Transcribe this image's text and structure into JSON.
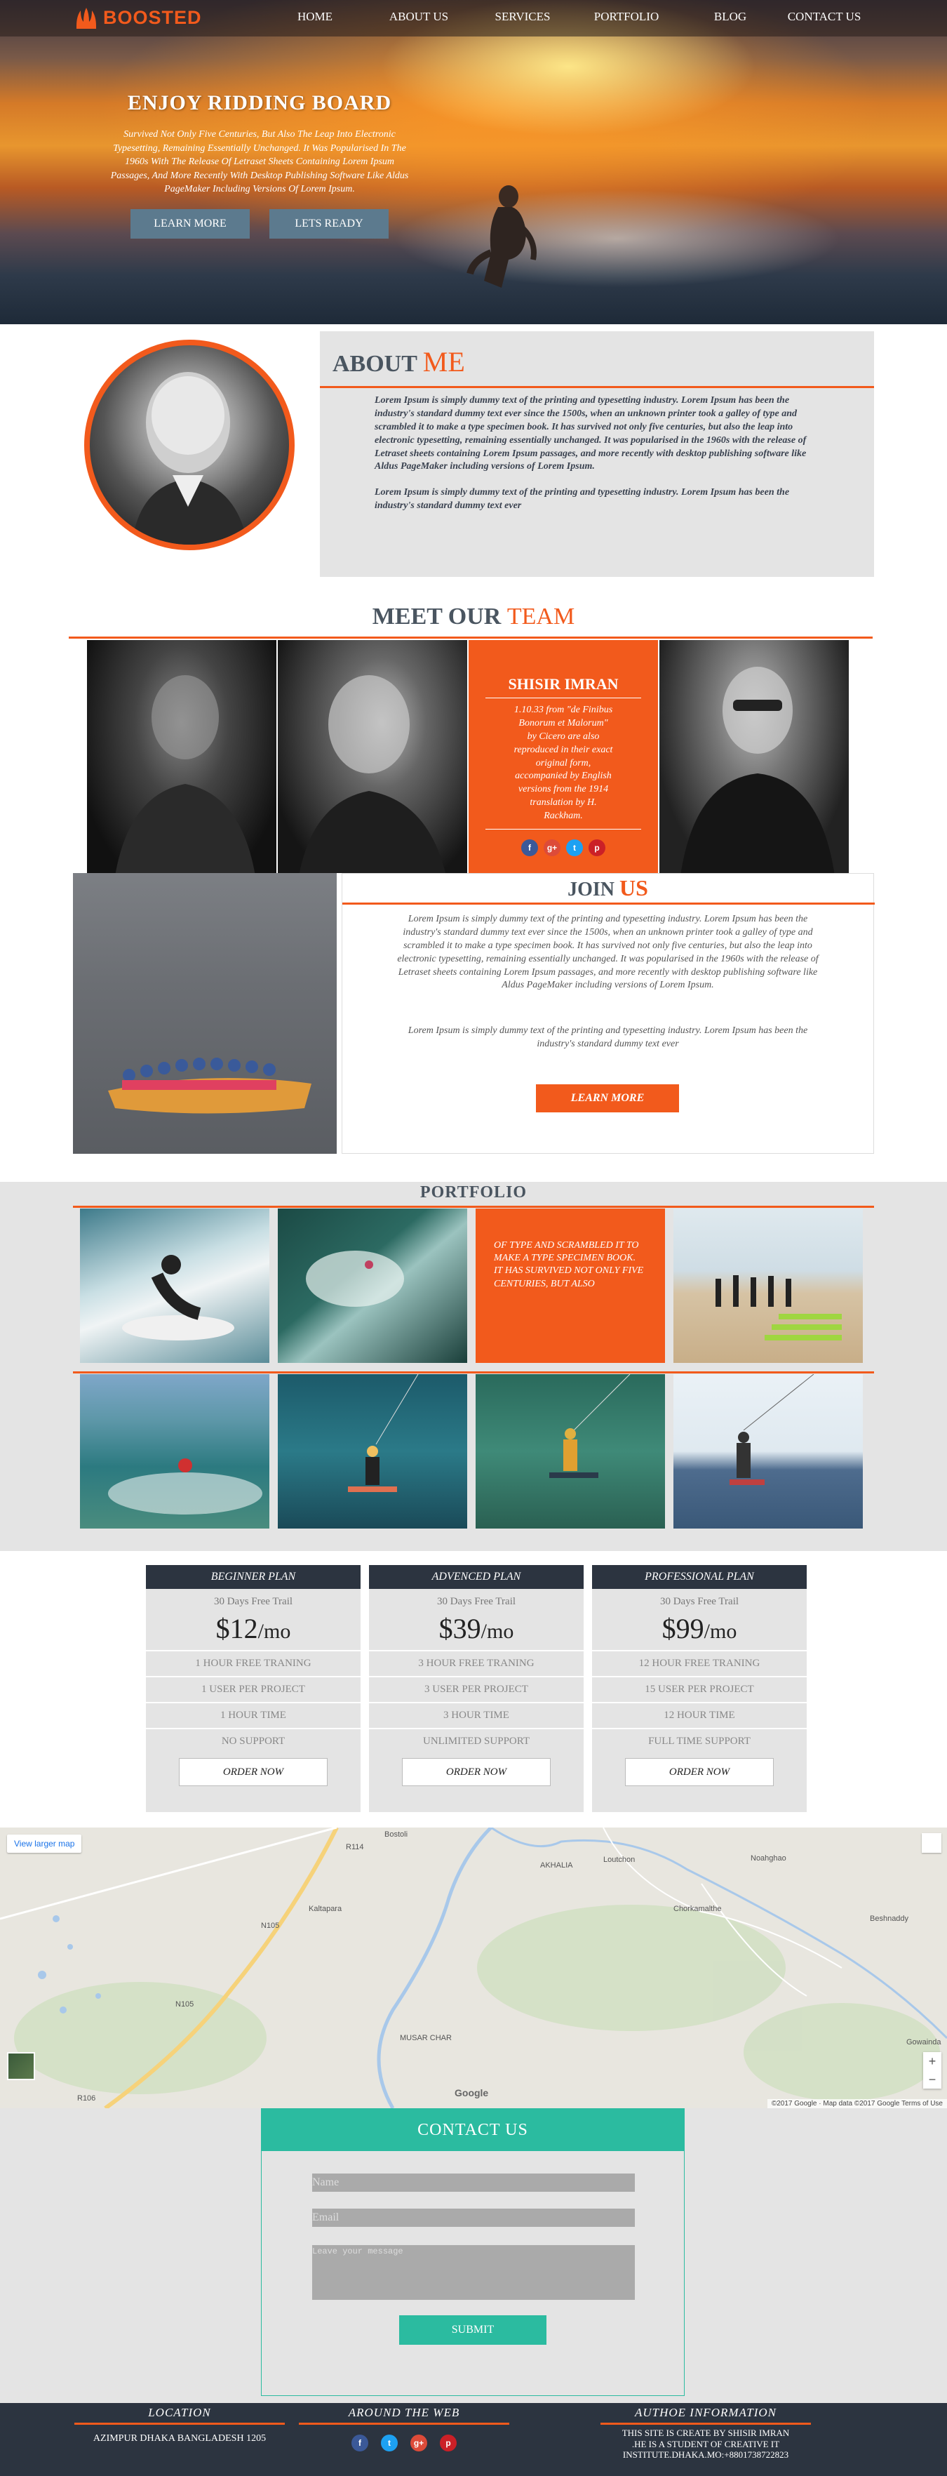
{
  "nav": {
    "logo": "BOOSTED",
    "items": [
      "HOME",
      "ABOUT US",
      "SERVICES",
      "PORTFOLIO",
      "BLOG",
      "CONTACT US"
    ]
  },
  "hero": {
    "title": "ENJOY RIDDING BOARD",
    "text": "Survived Not Only Five Centuries, But Also The Leap Into Electronic Typesetting, Remaining Essentially Unchanged. It Was Popularised In The 1960s With The Release Of Letraset Sheets Containing Lorem Ipsum Passages, And More Recently With Desktop Publishing Software Like Aldus PageMaker Including Versions Of Lorem Ipsum.",
    "btn_learn": "LEARN MORE",
    "btn_ready": "LETS READY"
  },
  "about": {
    "title": "ABOUT",
    "title_accent": "ME",
    "p1": "Lorem Ipsum is simply dummy text of the printing and typesetting industry. Lorem Ipsum has been the industry's standard dummy text ever since the 1500s, when an unknown printer took a galley of type and scrambled it to make a type specimen book. It has survived not only five centuries, but also the leap into electronic typesetting, remaining essentially unchanged. It was popularised in the 1960s with the release of Letraset sheets containing Lorem Ipsum passages, and more recently with desktop publishing software like Aldus PageMaker including versions of Lorem Ipsum.",
    "p2": "Lorem Ipsum is simply dummy text of the printing and typesetting industry. Lorem Ipsum has been the industry's standard dummy text ever"
  },
  "team": {
    "title": "MEET OUR",
    "title_accent": "TEAM",
    "featured_name": "SHISIR IMRAN",
    "featured_desc": "1.10.33 from \"de Finibus Bonorum et Malorum\" by Cicero are also reproduced in their exact original form, accompanied by English versions from the 1914 translation by H. Rackham.",
    "socials": [
      "f",
      "g+",
      "t",
      "p"
    ]
  },
  "join": {
    "title": "JOIN",
    "title_accent": "US",
    "p1": "Lorem Ipsum is simply dummy text of the printing and typesetting industry. Lorem Ipsum has been the industry's standard dummy text ever since the 1500s, when an unknown printer took a galley of type and scrambled it to make a type specimen book. It has survived not only five centuries, but also the leap into electronic typesetting, remaining essentially unchanged. It was popularised in the 1960s with the release of Letraset sheets containing Lorem Ipsum passages, and more recently with desktop publishing software like Aldus PageMaker including versions of Lorem Ipsum.",
    "p2": "Lorem Ipsum is simply dummy text of the printing and typesetting industry. Lorem Ipsum has been the industry's standard dummy text ever",
    "button": "LEARN MORE"
  },
  "portfolio": {
    "title": "PORTFOLIO",
    "caption": "OF TYPE AND SCRAMBLED IT TO MAKE A TYPE SPECIMEN BOOK. IT HAS SURVIVED NOT ONLY FIVE CENTURIES, BUT ALSO"
  },
  "pricing": {
    "plans": [
      {
        "name": "BEGINNER PLAN",
        "trail": "30 Days Free Trail",
        "price": "$12",
        "per": "/mo",
        "features": [
          "1 HOUR FREE TRANING",
          "1 USER PER PROJECT",
          "1 HOUR TIME",
          "NO SUPPORT"
        ],
        "order": "ORDER NOW"
      },
      {
        "name": "ADVENCED PLAN",
        "trail": "30 Days Free Trail",
        "price": "$39",
        "per": "/mo",
        "features": [
          "3 HOUR FREE TRANING",
          "3 USER PER PROJECT",
          "3 HOUR TIME",
          "UNLIMITED SUPPORT"
        ],
        "order": "ORDER NOW"
      },
      {
        "name": "PROFESSIONAL PLAN",
        "trail": "30 Days Free Trail",
        "price": "$99",
        "per": "/mo",
        "features": [
          "12 HOUR FREE TRANING",
          "15 USER PER PROJECT",
          "12 HOUR TIME",
          "FULL TIME SUPPORT"
        ],
        "order": "ORDER NOW"
      }
    ]
  },
  "map": {
    "view_larger": "View larger map",
    "labels": [
      "Bostoli",
      "AKHALIA",
      "Loutchon",
      "Noahghao",
      "Kaltapara",
      "Chorkamalthe",
      "Beshnaddy",
      "MUSAR CHAR",
      "Gowainda"
    ],
    "road_labels": [
      "R114",
      "N105",
      "N105",
      "R106"
    ],
    "google": "Google",
    "footer": "©2017 Google · Map data ©2017 Google    Terms of Use",
    "zoom_in": "+",
    "zoom_out": "−"
  },
  "contact": {
    "title": "CONTACT US",
    "name_placeholder": "Name",
    "email_placeholder": "Email",
    "message_placeholder": "Leave your message",
    "submit": "SUBMIT"
  },
  "footer": {
    "location_title": "LOCATION",
    "location_text": "AZIMPUR DHAKA BANGLADESH 1205",
    "web_title": "AROUND THE WEB",
    "author_title": "AUTHOE INFORMATION",
    "author_text": "THIS SITE IS CREATE BY SHISIR IMRAN .HE IS A STUDENT OF CREATIVE IT INSTITUTE.DHAKA.MO:+8801738722823",
    "socials": [
      "f",
      "t",
      "g+",
      "p"
    ]
  },
  "colors": {
    "accent": "#f25a1c",
    "dark": "#2c3440",
    "teal": "#2bbba0"
  }
}
